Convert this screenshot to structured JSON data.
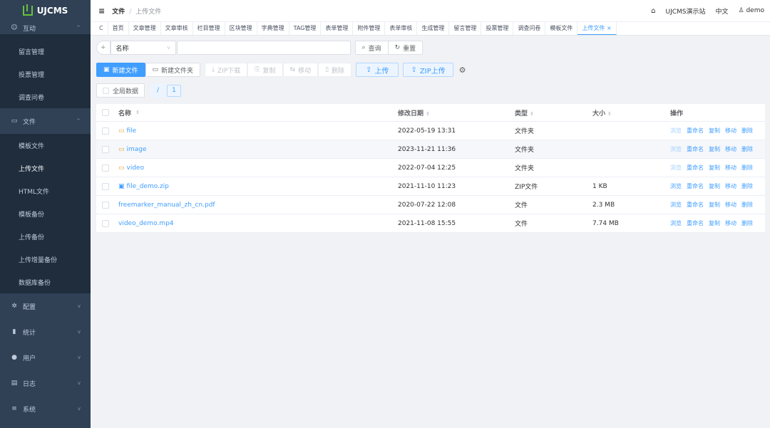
{
  "app": {
    "logo_text": "UJCMS"
  },
  "sidebar": {
    "groups": [
      {
        "icon": "chat-icon",
        "glyph": "☺",
        "label": "互动",
        "chev": "^"
      },
      {
        "icon": "folder-icon",
        "glyph": "▭",
        "label": "文件",
        "chev": "^"
      },
      {
        "icon": "gear-icon",
        "glyph": "✲",
        "label": "配置",
        "chev": "v"
      },
      {
        "icon": "chart-icon",
        "glyph": "▮",
        "label": "统计",
        "chev": "v"
      },
      {
        "icon": "user-icon",
        "glyph": "●",
        "label": "用户",
        "chev": "v"
      },
      {
        "icon": "log-icon",
        "glyph": "▤",
        "label": "日志",
        "chev": "v"
      },
      {
        "icon": "settings-icon",
        "glyph": "≡",
        "label": "系统",
        "chev": "v"
      }
    ],
    "interact_items": [
      "留言管理",
      "投票管理",
      "调查问卷"
    ],
    "file_items": [
      "模板文件",
      "上传文件",
      "HTML文件",
      "模板备份",
      "上传备份",
      "上传增量备份",
      "数据库备份"
    ],
    "active_item": "上传文件"
  },
  "header": {
    "breadcrumb_1": "文件",
    "breadcrumb_sep": "/",
    "breadcrumb_2": "上传文件",
    "site": "UJCMS演示站",
    "lang": "中文",
    "user": "demo"
  },
  "tabs": {
    "refresh": "C",
    "items": [
      "首页",
      "文章管理",
      "文章审核",
      "栏目管理",
      "区块管理",
      "字典管理",
      "TAG管理",
      "表单管理",
      "附件管理",
      "表单审核",
      "生成管理",
      "留言管理",
      "投票管理",
      "调查问卷",
      "模板文件"
    ],
    "active": "上传文件",
    "close": "×"
  },
  "search": {
    "add": "+",
    "field_select": "名称",
    "input_value": "",
    "query": "查询",
    "reset": "重置"
  },
  "toolbar": {
    "new_file": "新建文件",
    "new_folder": "新建文件夹",
    "zip_download": "ZIP下载",
    "copy": "复制",
    "move": "移动",
    "delete": "删除",
    "upload": "上传",
    "zip_upload": "ZIP上传"
  },
  "path_bar": {
    "global_data": "全局数据",
    "root": "/",
    "page": "1"
  },
  "table": {
    "headers": {
      "name": "名称",
      "date": "修改日期",
      "type": "类型",
      "size": "大小",
      "ops": "操作"
    },
    "ops": [
      "浏览",
      "重命名",
      "复制",
      "移动",
      "删除"
    ],
    "rows": [
      {
        "kind": "folder",
        "name": "file",
        "date": "2022-05-19 13:31",
        "type": "文件夹",
        "size": ""
      },
      {
        "kind": "folder",
        "name": "image",
        "date": "2023-11-21 11:36",
        "type": "文件夹",
        "size": ""
      },
      {
        "kind": "folder",
        "name": "video",
        "date": "2022-07-04 12:25",
        "type": "文件夹",
        "size": ""
      },
      {
        "kind": "zip",
        "name": "file_demo.zip",
        "date": "2021-11-10 11:23",
        "type": "ZIP文件",
        "size": "1 KB"
      },
      {
        "kind": "file",
        "name": "freemarker_manual_zh_cn.pdf",
        "date": "2020-07-22 12:08",
        "type": "文件",
        "size": "2.3 MB"
      },
      {
        "kind": "file",
        "name": "video_demo.mp4",
        "date": "2021-11-08 15:55",
        "type": "文件",
        "size": "7.74 MB"
      }
    ]
  },
  "colors": {
    "sidebar_bg": "#304156",
    "primary": "#409eff",
    "folder": "#e6a23c"
  }
}
